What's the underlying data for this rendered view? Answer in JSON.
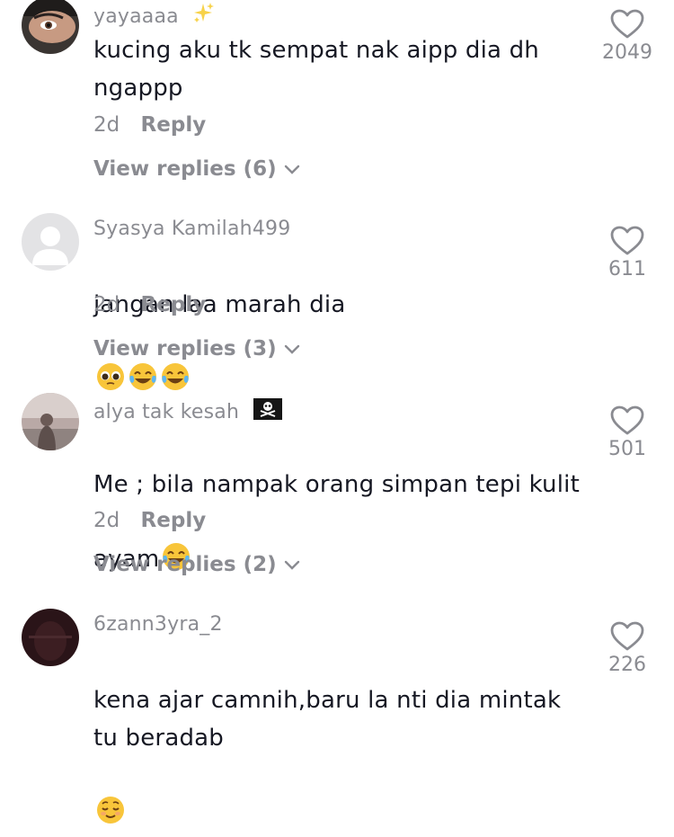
{
  "comments": [
    {
      "username": "yayaaaa",
      "badge_icon": "sparkles-icon",
      "text": "kucing aku tk sempat nak aipp dia dh ngappp",
      "time": "2d",
      "reply_label": "Reply",
      "view_replies": "View replies (6)",
      "likes": "2049"
    },
    {
      "username": "Syasya Kamilah499",
      "text": "jangan laa marah dia",
      "emojis": [
        "pleading-face-emoji",
        "tears-of-joy-emoji",
        "tears-of-joy-emoji"
      ],
      "time": "2d",
      "reply_label": "Reply",
      "view_replies": "View replies (3)",
      "likes": "611"
    },
    {
      "username": "alya tak kesah",
      "badge_icon": "pirate-flag-icon",
      "text": "Me ; bila nampak orang simpan tepi kulit ayam",
      "emojis": [
        "tears-of-joy-emoji"
      ],
      "time": "2d",
      "reply_label": "Reply",
      "view_replies": "View replies (2)",
      "likes": "501"
    },
    {
      "username": "6zann3yra_2",
      "text": "kena ajar camnih,baru la nti dia mintak tu beradab",
      "emojis": [
        "relieved-face-emoji"
      ],
      "likes": "226"
    }
  ],
  "colors": {
    "text": "#161823",
    "secondary": "#8a8b91",
    "background": "#ffffff"
  }
}
